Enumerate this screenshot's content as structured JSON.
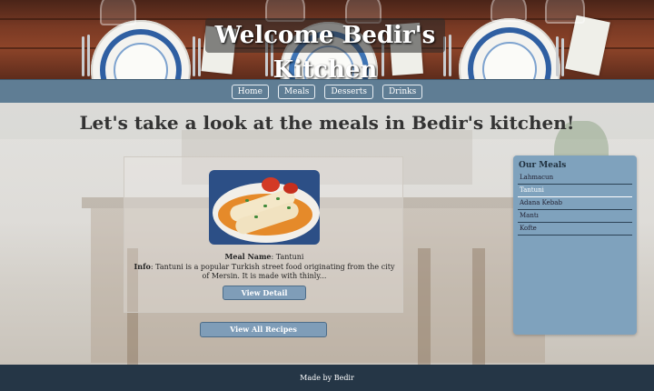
{
  "header": {
    "title": "Welcome Bedir's Kitchen"
  },
  "nav": {
    "items": [
      "Home",
      "Meals",
      "Desserts",
      "Drinks"
    ]
  },
  "main": {
    "heading": "Let's take a look at the meals in Bedir's kitchen!",
    "meal": {
      "name_label": "Meal Name",
      "name_value": ": Tantuni",
      "info_label": "Info",
      "info_value": ": Tantuni is a popular Turkish street food originating from the city of Mersin. It is made with thinly...",
      "detail_button": "View Detail"
    },
    "all_recipes_button": "View All Recipes"
  },
  "sidebar": {
    "title": "Our Meals",
    "items": [
      "Lahmacun",
      "Tantuni",
      "Adana Kebab",
      "Mantı",
      "Kofte"
    ],
    "active_index": 1
  },
  "footer": {
    "text": "Made by Bedir"
  }
}
